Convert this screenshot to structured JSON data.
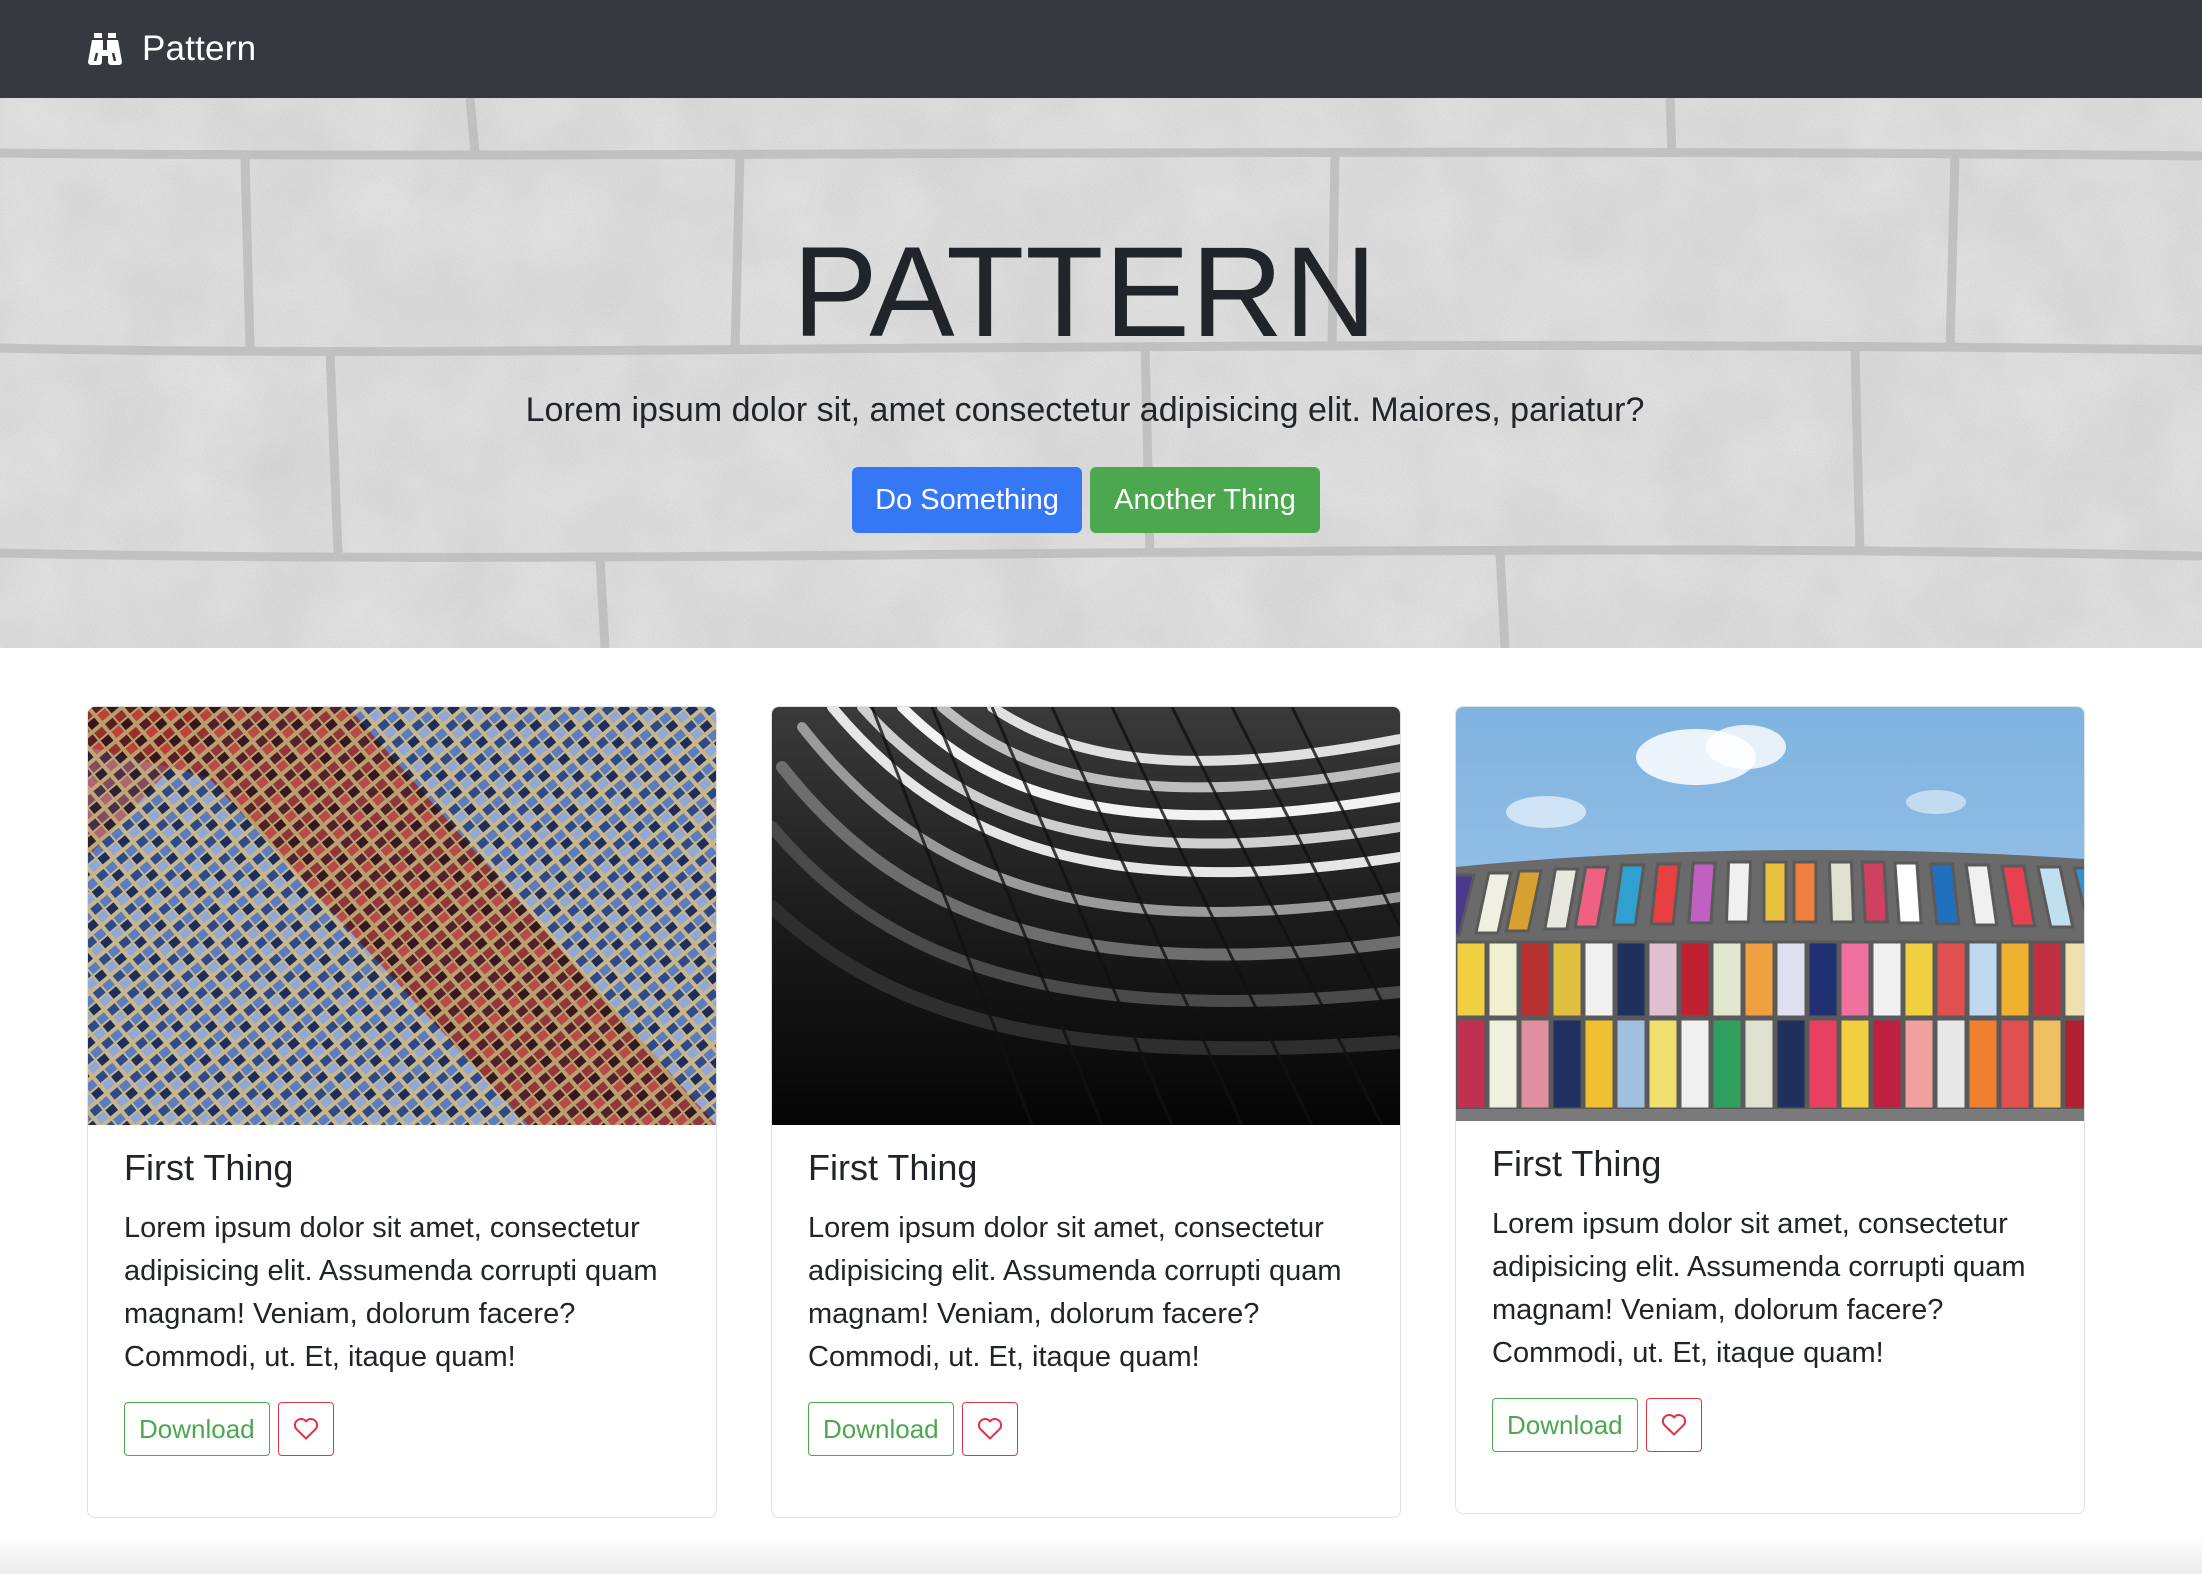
{
  "navbar": {
    "brand_icon": "binoculars-icon",
    "brand_text": "Pattern",
    "background": "#343a40"
  },
  "hero": {
    "title": "PATTERN",
    "lead": "Lorem ipsum dolor sit, amet consectetur adipisicing elit. Maiores, pariatur?",
    "primary_button": "Do Something",
    "secondary_button": "Another Thing",
    "primary_color": "#3578f6",
    "secondary_color": "#4ba84f"
  },
  "cards": [
    {
      "image": "blue-red-building-facade",
      "title": "First Thing",
      "text": "Lorem ipsum dolor sit amet, consectetur adipisicing elit. Assumenda corrupti quam magnam! Veniam, dolorum facere? Commodi, ut. Et, itaque quam!",
      "download_label": "Download",
      "favorite_icon": "heart-icon"
    },
    {
      "image": "black-white-curved-architecture",
      "title": "First Thing",
      "text": "Lorem ipsum dolor sit amet, consectetur adipisicing elit. Assumenda corrupti quam magnam! Veniam, dolorum facere? Commodi, ut. Et, itaque quam!",
      "download_label": "Download",
      "favorite_icon": "heart-icon"
    },
    {
      "image": "colorful-glass-panels-sky",
      "title": "First Thing",
      "text": "Lorem ipsum dolor sit amet, consectetur adipisicing elit. Assumenda corrupti quam magnam! Veniam, dolorum facere? Commodi, ut. Et, itaque quam!",
      "download_label": "Download",
      "favorite_icon": "heart-icon"
    }
  ]
}
